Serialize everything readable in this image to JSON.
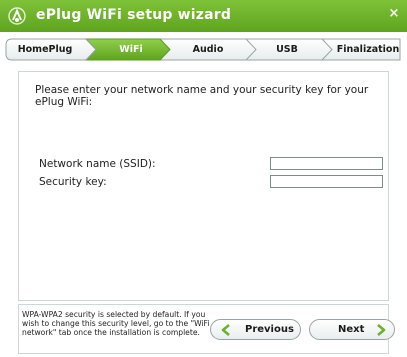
{
  "window": {
    "title": "ePlug WiFi setup wizard",
    "close_symbol": "×"
  },
  "colors": {
    "brand_green": "#6db22c",
    "active_step": "#73b832"
  },
  "steps": [
    {
      "label": "HomePlug",
      "active": false
    },
    {
      "label": "WiFi",
      "active": true
    },
    {
      "label": "Audio",
      "active": false
    },
    {
      "label": "USB",
      "active": false
    },
    {
      "label": "Finalization",
      "active": false
    }
  ],
  "main": {
    "intro": "Please enter your network name and your security key for your ePlug WiFi:",
    "ssid_label": "Network name (SSID):",
    "ssid_value": "",
    "key_label": "Security key:",
    "key_value": ""
  },
  "footer": {
    "note": "WPA-WPA2 security is selected by default. If you wish to change this security level, go to the \"WiFi network\" tab once the installation is complete.",
    "previous_label": "Previous",
    "next_label": "Next",
    "previous_icon": "arrow-left-icon",
    "next_icon": "arrow-right-icon"
  }
}
